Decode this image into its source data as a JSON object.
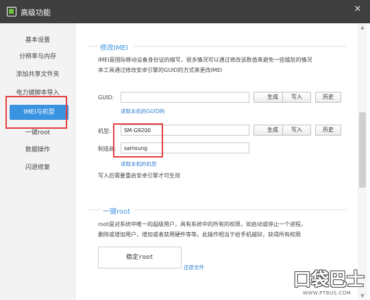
{
  "window": {
    "title": "高级功能"
  },
  "sidebar": {
    "items": [
      {
        "label": "基本设置"
      },
      {
        "label": "分辨率与内存"
      },
      {
        "label": "添加共享文件夹"
      },
      {
        "label": "电力键脚本导入"
      },
      {
        "label": "IMEI与机型"
      },
      {
        "label": "一键root"
      },
      {
        "label": "数据操作"
      },
      {
        "label": "闪退修复"
      }
    ],
    "active_index": 4
  },
  "imei_section": {
    "heading": "修改IMEI",
    "desc_line1": "IMEI是国际移动设备身份证的缩写，很多情况可以通过修改该数值来避免一些尴尬的情况",
    "desc_line2": "本工具通过修改安卓引擎的GUID的方式来更改IMEI",
    "guid_label": "GUID:",
    "guid_value": "",
    "generate_label": "生成",
    "write_label": "写入",
    "history_label": "历史",
    "read_guid_link": "读取本机的GUID码",
    "model_label": "机型:",
    "model_value": "SM-G9200",
    "manufacturer_label": "制造商:",
    "manufacturer_value": "samsung",
    "read_model_link": "读取本机的机型",
    "restart_note": "写入后需要重启安卓引擎才可生效"
  },
  "root_section": {
    "heading": "一键root",
    "desc_line1": "root是对系统中唯一的超级用户，具有系统中的所有的权限，如启动或停止一个进程，",
    "desc_line2": "删除或增加用户，增加或者禁用硬件等等。此操作相当于给手机越狱，获得所有权限",
    "root_button_label": "稳定root",
    "restore_link": "还原文件"
  },
  "watermark": {
    "text": "口袋巴士",
    "url": "WWW.PTBUS.COM"
  },
  "colors": {
    "accent": "#3a93e0",
    "highlight": "#e43d3d",
    "titlebar": "#3f3f3f"
  }
}
